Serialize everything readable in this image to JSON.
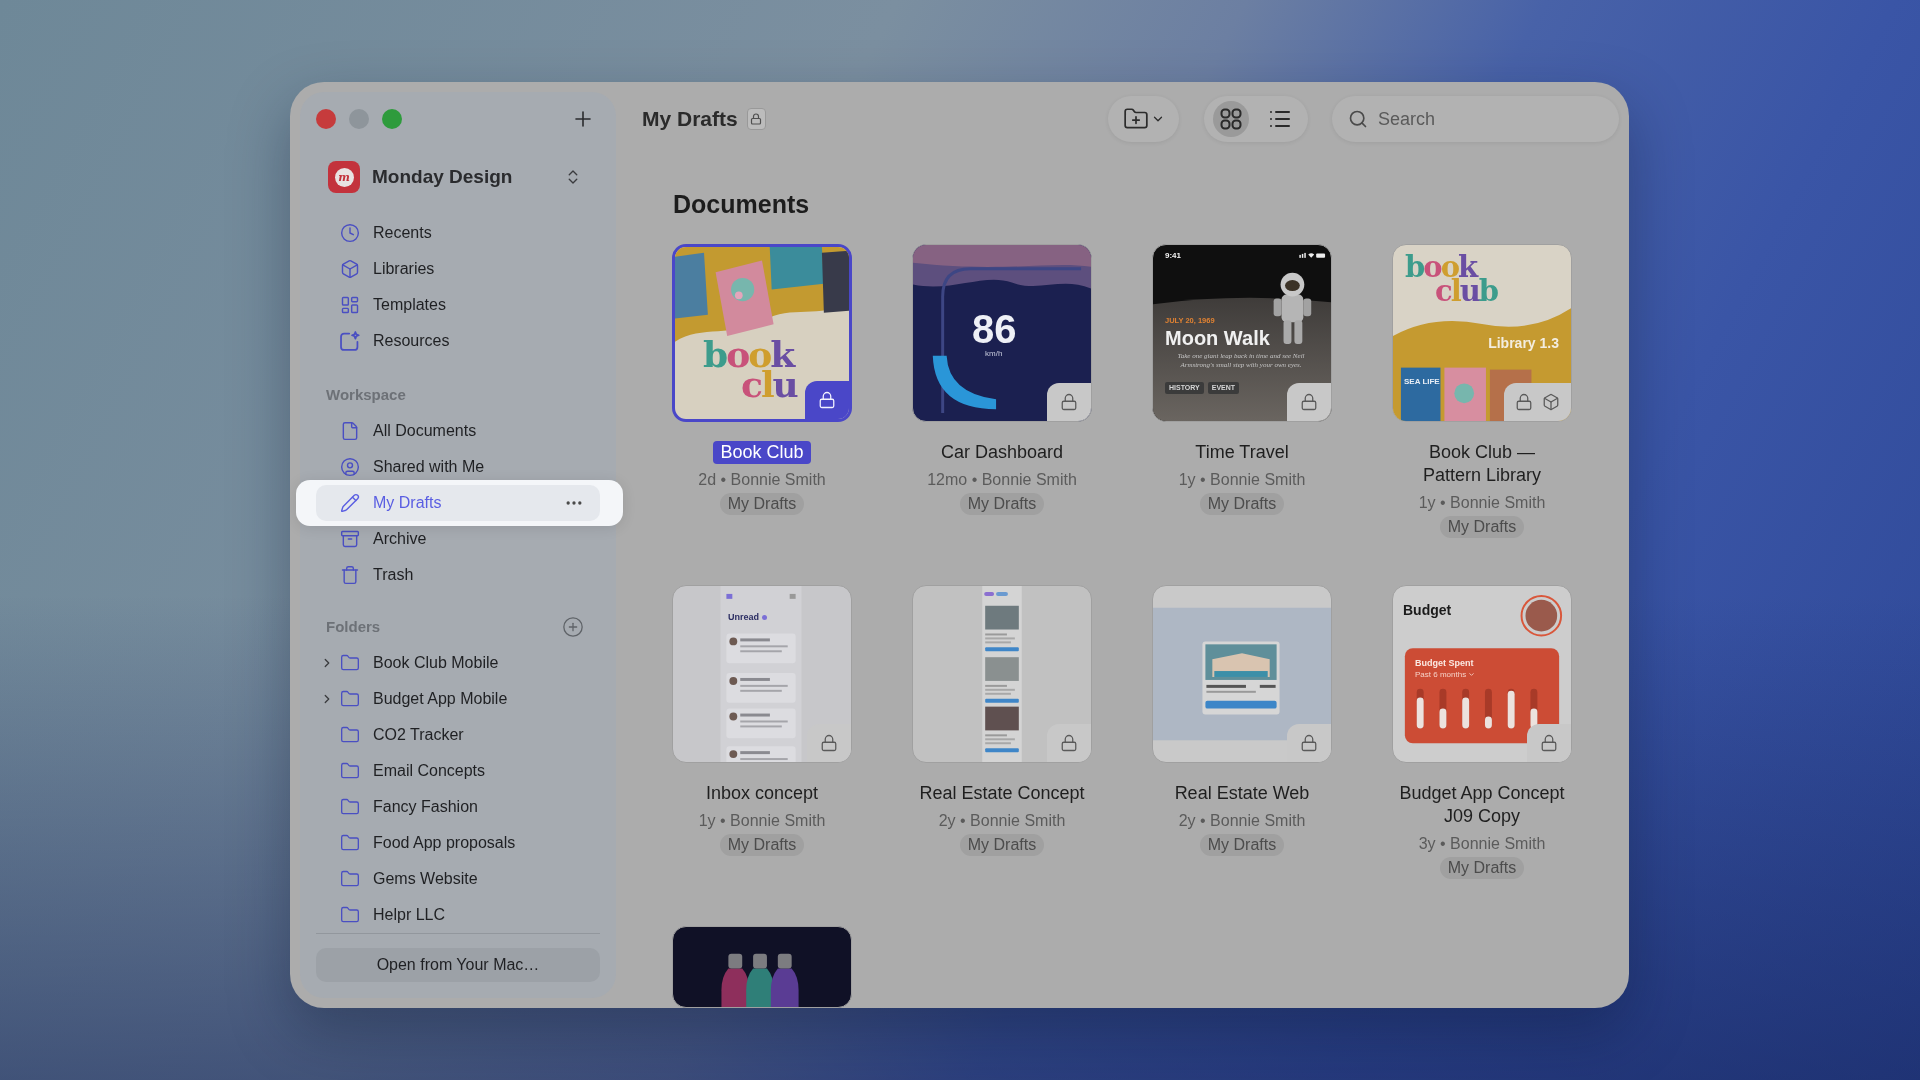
{
  "sidebar": {
    "workspace": {
      "logo_letter": "m",
      "name": "Monday Design"
    },
    "groups": [
      {
        "items": [
          {
            "label": "Recents",
            "selected": false
          },
          {
            "label": "Libraries",
            "selected": false
          },
          {
            "label": "Templates",
            "selected": false
          },
          {
            "label": "Resources",
            "selected": false
          }
        ]
      },
      {
        "title": "Workspace",
        "items": [
          {
            "label": "All Documents",
            "selected": false
          },
          {
            "label": "Shared with Me",
            "selected": false
          },
          {
            "label": "My Drafts",
            "selected": true
          },
          {
            "label": "Archive",
            "selected": false
          },
          {
            "label": "Trash",
            "selected": false
          }
        ]
      }
    ],
    "folders": {
      "title": "Folders",
      "items": [
        {
          "label": "Book Club Mobile",
          "expanded": false,
          "selected": false
        },
        {
          "label": "Budget App Mobile",
          "expanded": false,
          "selected": false
        },
        {
          "label": "CO2 Tracker",
          "selected": false
        },
        {
          "label": "Email Concepts",
          "selected": false
        },
        {
          "label": "Fancy Fashion",
          "selected": false
        },
        {
          "label": "Food App proposals",
          "selected": false
        },
        {
          "label": "Gems Website",
          "selected": false
        },
        {
          "label": "Helpr LLC",
          "selected": false
        }
      ]
    },
    "open_button": "Open from Your Mac…"
  },
  "header": {
    "title": "My Drafts",
    "locked": true
  },
  "toolbar": {
    "views": [
      {
        "kind": "grid",
        "selected": true
      },
      {
        "kind": "list",
        "selected": false
      }
    ],
    "search": {
      "placeholder": "Search"
    }
  },
  "documents": {
    "title": "Documents",
    "items": [
      {
        "title": "Book Club",
        "meta": "2d • Bonnie Smith",
        "folder": "My Drafts",
        "selected": true,
        "locked": true,
        "library": false,
        "preview": {
          "kind": "bookclub",
          "lines": [
            "book",
            "clu"
          ]
        }
      },
      {
        "title": "Car Dashboard",
        "meta": "12mo • Bonnie Smith",
        "folder": "My Drafts",
        "selected": false,
        "locked": true,
        "library": false,
        "preview": {
          "kind": "dashboard",
          "speed": "86",
          "unit": "km/h"
        }
      },
      {
        "title": "Time Travel",
        "meta": "1y • Bonnie Smith",
        "folder": "My Drafts",
        "selected": false,
        "locked": true,
        "library": false,
        "preview": {
          "kind": "moonwalk",
          "time": "9:41",
          "date": "JULY 20, 1969",
          "title": "Moon Walk",
          "body": "Take one giant leap back in time and see Neil Armstrong's small step with your own eyes.",
          "tags": [
            "HISTORY",
            "EVENT"
          ]
        }
      },
      {
        "title": "Book Club —\nPattern Library",
        "meta": "1y • Bonnie Smith",
        "folder": "My Drafts",
        "selected": false,
        "locked": true,
        "library": true,
        "preview": {
          "kind": "library",
          "lines": [
            "book",
            "club"
          ],
          "label": "Library 1.3",
          "cover": "SEA LIFE"
        }
      },
      {
        "title": "Inbox concept",
        "meta": "1y • Bonnie Smith",
        "folder": "My Drafts",
        "selected": false,
        "locked": true,
        "library": false,
        "preview": {
          "kind": "inbox",
          "heading": "Unread"
        }
      },
      {
        "title": "Real Estate Concept",
        "meta": "2y • Bonnie Smith",
        "folder": "My Drafts",
        "selected": false,
        "locked": true,
        "library": false,
        "preview": {
          "kind": "listing_mobile"
        }
      },
      {
        "title": "Real Estate Web",
        "meta": "2y • Bonnie Smith",
        "folder": "My Drafts",
        "selected": false,
        "locked": true,
        "library": false,
        "preview": {
          "kind": "listing_web"
        }
      },
      {
        "title": "Budget App Concept\nJ09 Copy",
        "meta": "3y • Bonnie Smith",
        "folder": "My Drafts",
        "selected": false,
        "locked": true,
        "library": false,
        "preview": {
          "kind": "budget",
          "title": "Budget",
          "card_title": "Budget Spent",
          "period": "Past 6 months"
        }
      },
      {
        "selected": false,
        "preview": {
          "kind": "bottles"
        }
      }
    ]
  }
}
